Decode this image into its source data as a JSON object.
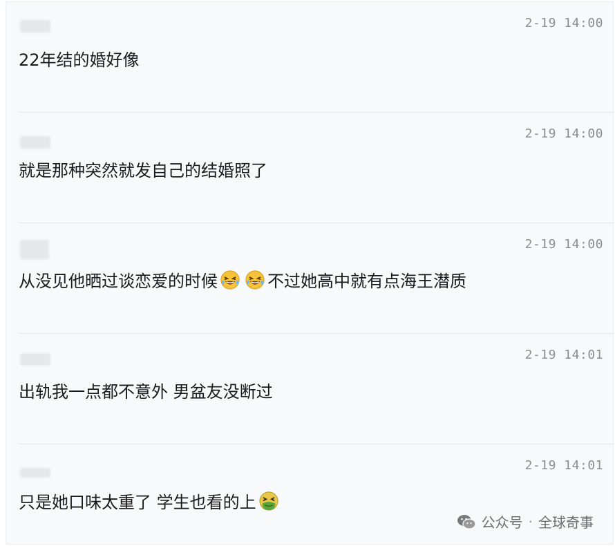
{
  "comments": [
    {
      "time": "2-19 14:00",
      "text": "22年结的婚好像"
    },
    {
      "time": "2-19 14:00",
      "text": "就是那种突然就发自己的结婚照了"
    },
    {
      "time": "2-19 14:00",
      "text_before": "从没见他晒过谈恋爱的时候",
      "emoji": "laughing-tears-emoji",
      "text_after": "不过她高中就有点海王潜质"
    },
    {
      "time": "2-19 14:01",
      "text": "出轨我一点都不意外 男盆友没断过"
    },
    {
      "time": "2-19 14:01",
      "text": "只是她口味太重了 学生也看的上",
      "emoji": "nauseated-face-emoji"
    }
  ],
  "watermark": {
    "source": "公众号",
    "separator": "·",
    "account": "全球奇事",
    "icon": "wechat-icon"
  },
  "colors": {
    "background": "#f8f9fb",
    "text": "#1b1b1b",
    "time": "#8a8d93",
    "divider": "#e4e6ea"
  }
}
